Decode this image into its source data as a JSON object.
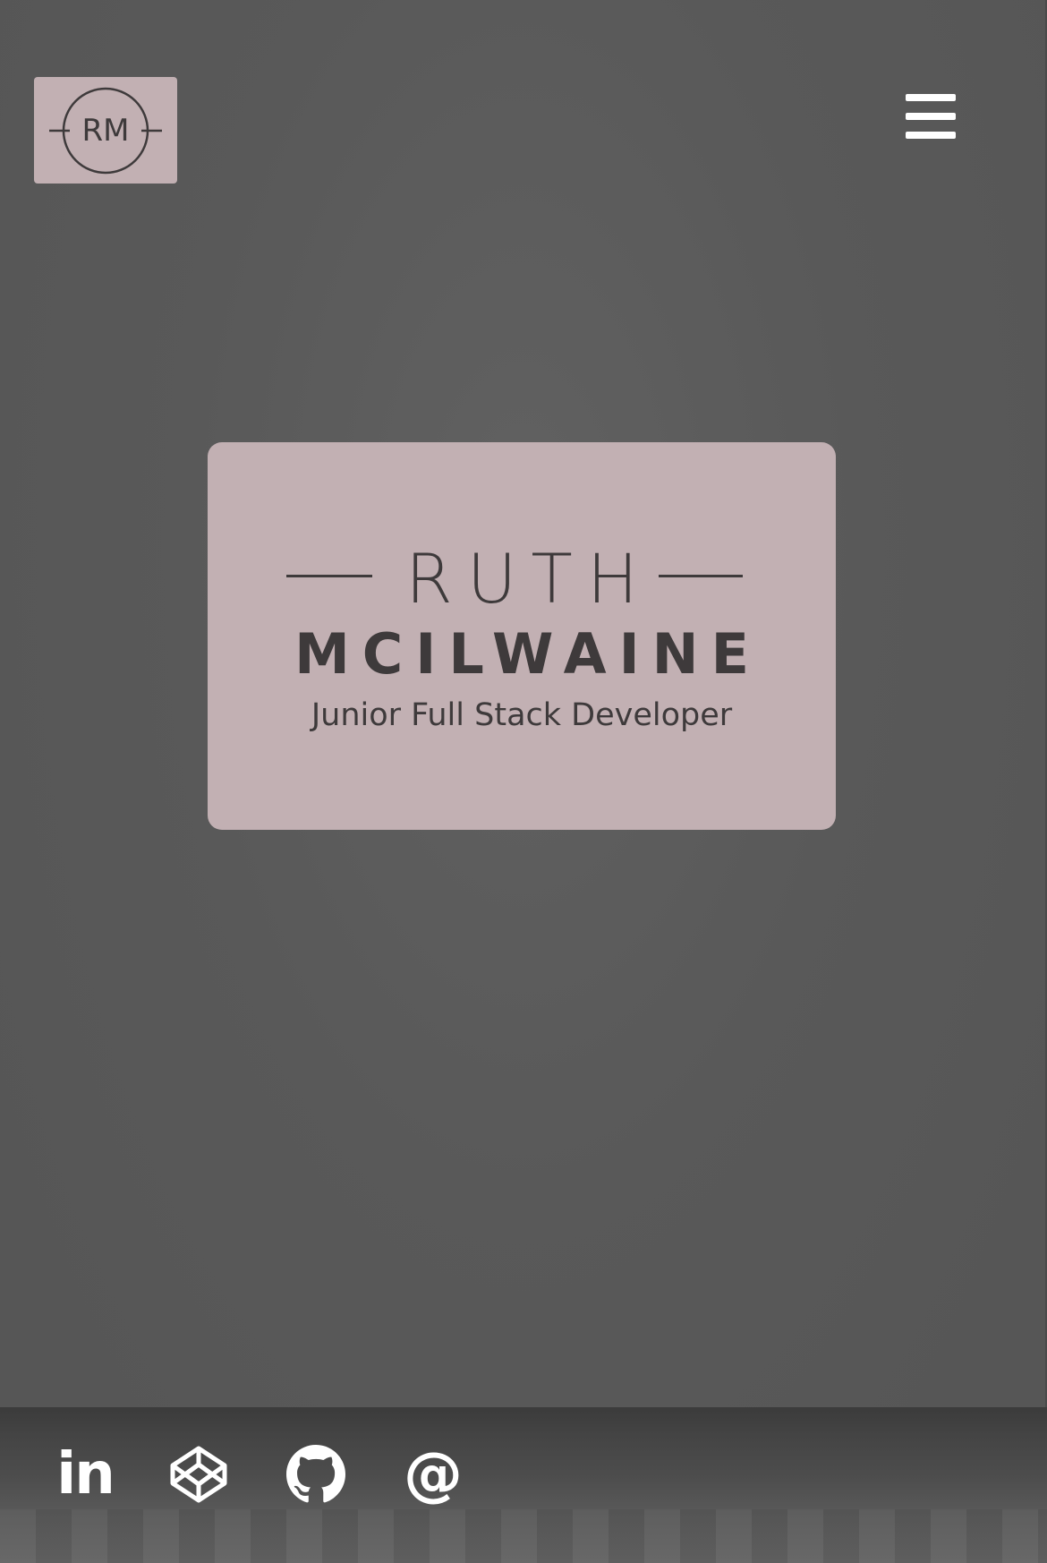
{
  "header": {
    "logo_monogram": "RM",
    "menu_icon": "hamburger-menu-icon"
  },
  "hero": {
    "first_name": "RUTH",
    "last_name": "MCILWAINE",
    "role": "Junior Full Stack Developer"
  },
  "social": {
    "linkedin": {
      "icon": "linkedin-icon",
      "glyph": "in"
    },
    "codepen": {
      "icon": "codepen-icon"
    },
    "github": {
      "icon": "github-icon"
    },
    "email": {
      "icon": "email-icon",
      "glyph": "@"
    }
  },
  "colors": {
    "background": "#595959",
    "card": "#c2b0b3",
    "text_dark": "#3e3a3b",
    "icon_light": "#ffffff"
  }
}
